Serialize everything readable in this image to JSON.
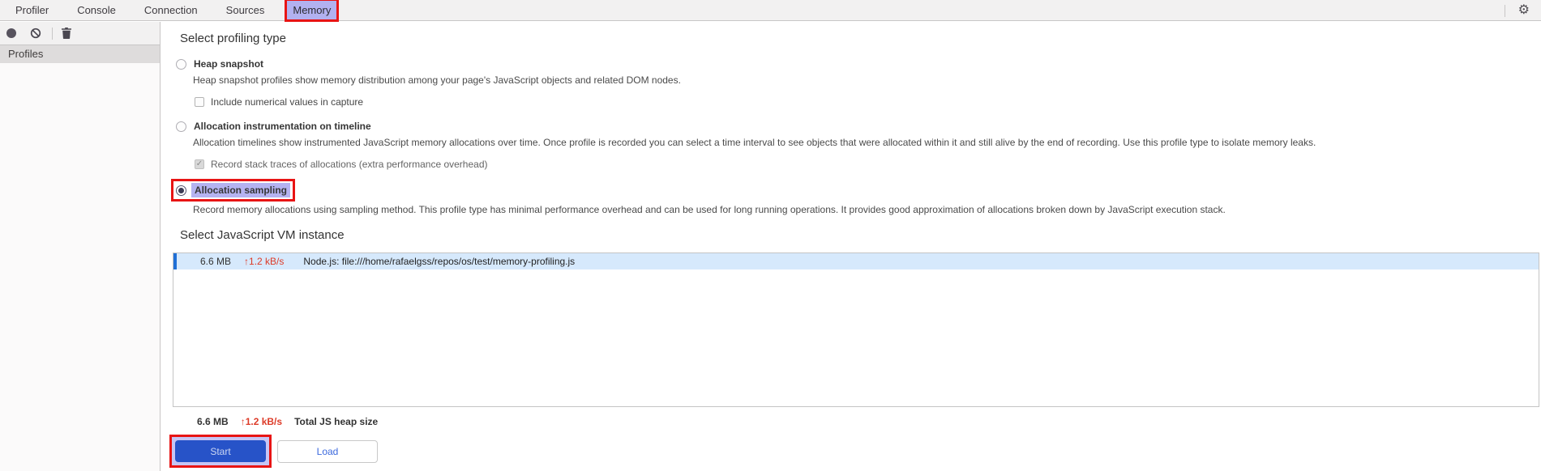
{
  "tabs": {
    "items": [
      {
        "label": "Profiler",
        "selected": false
      },
      {
        "label": "Console",
        "selected": false
      },
      {
        "label": "Connection",
        "selected": false
      },
      {
        "label": "Sources",
        "selected": false
      },
      {
        "label": "Memory",
        "selected": true
      }
    ]
  },
  "icons": {
    "gear": "⚙",
    "check": "✓",
    "record": "record-icon",
    "clear": "clear-icon",
    "delete": "trash-icon"
  },
  "sidebar": {
    "header": "Profiles"
  },
  "main": {
    "profiling_heading": "Select profiling type",
    "options": [
      {
        "label": "Heap snapshot",
        "selected": false,
        "desc": "Heap snapshot profiles show memory distribution among your page's JavaScript objects and related DOM nodes.",
        "child_checkbox": {
          "label": "Include numerical values in capture",
          "checked": false
        }
      },
      {
        "label": "Allocation instrumentation on timeline",
        "selected": false,
        "desc": "Allocation timelines show instrumented JavaScript memory allocations over time. Once profile is recorded you can select a time interval to see objects that were allocated within it and still alive by the end of recording. Use this profile type to isolate memory leaks.",
        "child_checkbox": {
          "label": "Record stack traces of allocations (extra performance overhead)",
          "checked": true,
          "disabled": true
        }
      },
      {
        "label": "Allocation sampling",
        "selected": true,
        "desc": "Record memory allocations using sampling method. This profile type has minimal performance overhead and can be used for long running operations. It provides good approximation of allocations broken down by JavaScript execution stack."
      }
    ],
    "vm_heading": "Select JavaScript VM instance",
    "vm_row": {
      "size": "6.6 MB",
      "up_arrow": "↑",
      "rate": "1.2 kB/s",
      "name": "Node.js: file:///home/rafaelgss/repos/os/test/memory-profiling.js"
    },
    "summary": {
      "size": "6.6 MB",
      "up_arrow": "↑",
      "rate": "1.2 kB/s",
      "label": "Total JS heap size"
    },
    "buttons": {
      "start": "Start",
      "load": "Load"
    }
  },
  "colors": {
    "selected_tab_bg": "#b2b1f0",
    "annotation_red": "#e81414",
    "vm_row_bg": "#d6e9fc",
    "vm_row_bar": "#1f6fd6",
    "rate_red": "#dd3b28",
    "start_button_blue": "#2753c8",
    "load_text_blue": "#3b69dd"
  }
}
